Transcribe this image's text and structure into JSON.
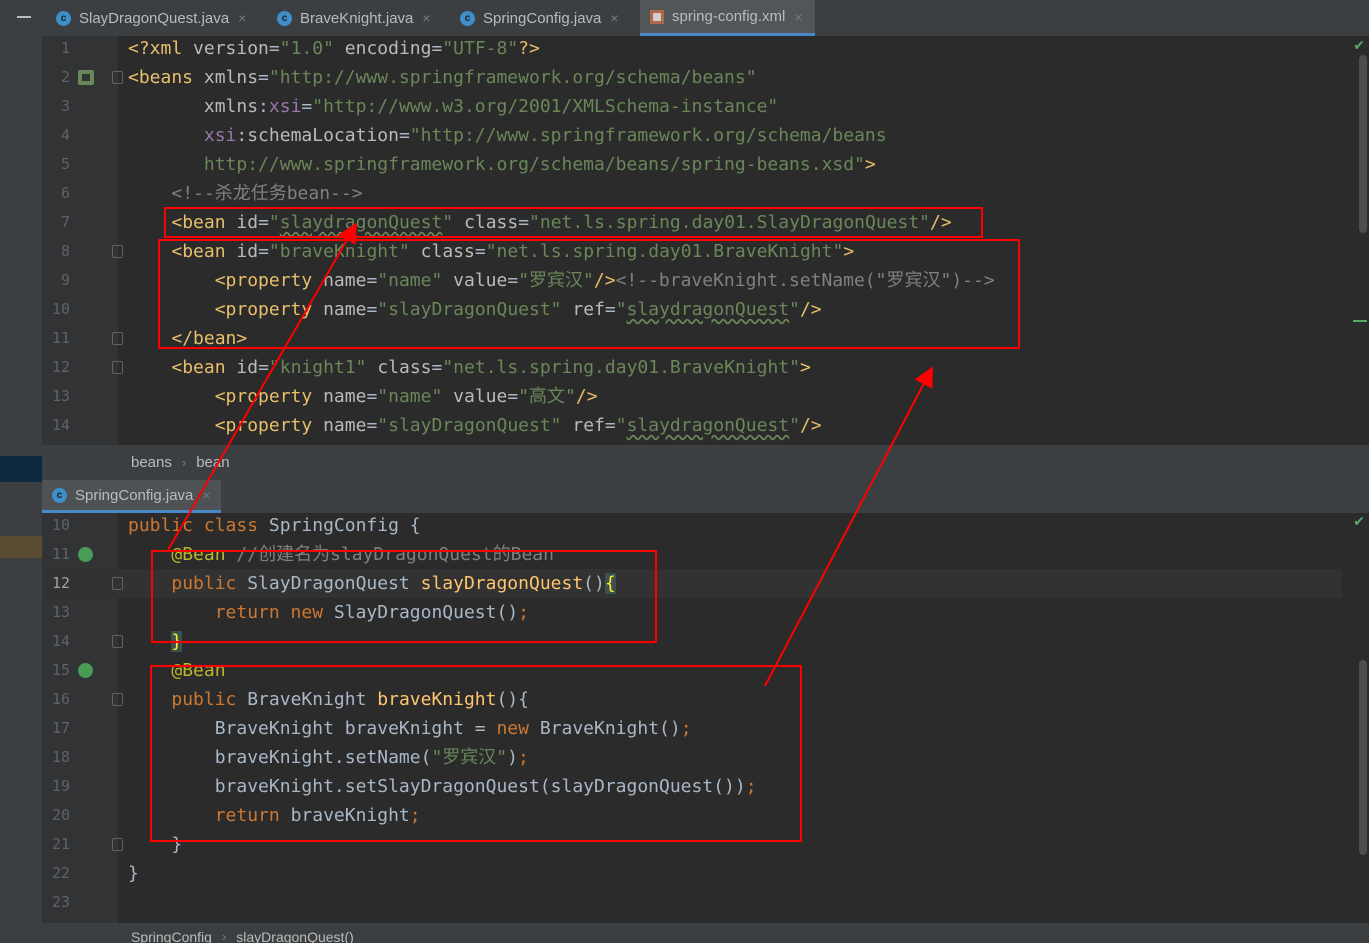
{
  "tabs": [
    {
      "label": "SlayDragonQuest.java",
      "icon": "java-class-icon",
      "close": "×"
    },
    {
      "label": "BraveKnight.java",
      "icon": "java-class-icon",
      "close": "×"
    },
    {
      "label": "SpringConfig.java",
      "icon": "java-class-icon",
      "close": "×"
    },
    {
      "label": "spring-config.xml",
      "icon": "xml-file-icon",
      "close": "×",
      "active": true
    }
  ],
  "xml_lines": [
    {
      "n": "1",
      "html": "<span class='t'>&lt;?xml </span><span class='an'>version</span>=<span class='av'>\"1.0\"</span> <span class='an'>encoding</span>=<span class='av'>\"UTF-8\"</span><span class='t'>?&gt;</span>"
    },
    {
      "n": "2",
      "html": "<span class='t'>&lt;beans </span><span class='an'>xmlns</span>=<span class='av'>\"http://www.springframework.org/schema/beans\"</span>"
    },
    {
      "n": "3",
      "html": "       <span class='an'>xmlns</span>:<span class='ns'>xsi</span>=<span class='av'>\"http://www.w3.org/2001/XMLSchema-instance\"</span>"
    },
    {
      "n": "4",
      "html": "       <span class='ns'>xsi</span>:<span class='an'>schemaLocation</span>=<span class='av'>\"http://www.springframework.org/schema/beans</span>"
    },
    {
      "n": "5",
      "html": "<span class='av'>       http://www.springframework.org/schema/beans/spring-beans.xsd\"</span><span class='t'>&gt;</span>"
    },
    {
      "n": "6",
      "html": "    <span class='cm'>&lt;!--杀龙任务bean--&gt;</span>"
    },
    {
      "n": "7",
      "html": "    <span class='t'>&lt;bean </span><span class='an'>id</span>=<span class='av'>\"<span class='wavy'>slaydragonQuest</span>\"</span> <span class='an'>class</span>=<span class='av'>\"net.ls.spring.day01.SlayDragonQuest\"</span><span class='t'>/&gt;</span>"
    },
    {
      "n": "8",
      "html": "    <span class='t'>&lt;bean </span><span class='an'>id</span>=<span class='av'>\"braveKnight\"</span> <span class='an'>class</span>=<span class='av'>\"net.ls.spring.day01.BraveKnight\"</span><span class='t'>&gt;</span>"
    },
    {
      "n": "9",
      "html": "        <span class='t'>&lt;property </span><span class='an'>name</span>=<span class='av'>\"name\"</span> <span class='an'>value</span>=<span class='av'>\"罗宾汉\"</span><span class='t'>/&gt;</span><span class='cm'>&lt;!--braveKnight.setName(\"罗宾汉\")--&gt;</span>"
    },
    {
      "n": "10",
      "html": "        <span class='t'>&lt;property </span><span class='an'>name</span>=<span class='av'>\"slayDragonQuest\"</span> <span class='an'>ref</span>=<span class='av'>\"<span class='wavy'>slaydragonQuest</span>\"</span><span class='t'>/&gt;</span>"
    },
    {
      "n": "11",
      "html": "    <span class='t'>&lt;/bean&gt;</span>"
    },
    {
      "n": "12",
      "html": "    <span class='t'>&lt;bean </span><span class='an'>id</span>=<span class='av'>\"knight1\"</span> <span class='an'>class</span>=<span class='av'>\"net.ls.spring.day01.BraveKnight\"</span><span class='t'>&gt;</span>"
    },
    {
      "n": "13",
      "html": "        <span class='t'>&lt;property </span><span class='an'>name</span>=<span class='av'>\"name\"</span> <span class='an'>value</span>=<span class='av'>\"高文\"</span><span class='t'>/&gt;</span>"
    },
    {
      "n": "14",
      "html": "        <span class='t'>&lt;property </span><span class='an'>name</span>=<span class='av'>\"slayDragonQuest\"</span> <span class='an'>ref</span>=<span class='av'>\"<span class='wavy'>slaydragonQuest</span>\"</span><span class='t'>/&gt;</span>"
    }
  ],
  "xml_breadcrumb": [
    "beans",
    "bean"
  ],
  "java_tab": {
    "label": "SpringConfig.java",
    "close": "×"
  },
  "java_lines": [
    {
      "n": "10",
      "html": "<span class='kw'>public class </span>SpringConfig {"
    },
    {
      "n": "11",
      "html": "    <span class='ann'>@Bean</span> <span class='cm'>//创建名为slayDragonQuest的Bean</span>"
    },
    {
      "n": "12",
      "html": "    <span class='kw'>public </span>SlayDragonQuest <span class='fn'>slayDragonQuest</span>()<span class='brace-hl'>{</span>"
    },
    {
      "n": "13",
      "html": "        <span class='kw'>return new </span>SlayDragonQuest()<span class='kw'>;</span>"
    },
    {
      "n": "14",
      "html": "    <span class='brace-hl'>}</span>"
    },
    {
      "n": "15",
      "html": "    <span class='ann'>@Bean</span>"
    },
    {
      "n": "16",
      "html": "    <span class='kw'>public </span>BraveKnight <span class='fn'>braveKnight</span>(){"
    },
    {
      "n": "17",
      "html": "        BraveKnight braveKnight = <span class='kw'>new </span>BraveKnight()<span class='kw'>;</span>"
    },
    {
      "n": "18",
      "html": "        braveKnight.setName(<span class='str'>\"罗宾汉\"</span>)<span class='kw'>;</span>"
    },
    {
      "n": "19",
      "html": "        braveKnight.setSlayDragonQuest(slayDragonQuest())<span class='kw'>;</span>"
    },
    {
      "n": "20",
      "html": "        <span class='kw'>return </span>braveKnight<span class='kw'>;</span>"
    },
    {
      "n": "21",
      "html": "    }"
    },
    {
      "n": "22",
      "html": "}"
    },
    {
      "n": "23",
      "html": ""
    }
  ],
  "java_breadcrumb": [
    "SpringConfig",
    "slayDragonQuest()"
  ],
  "colors": {
    "highlight_box": "#ff0000",
    "editor_bg": "#2b2b2b",
    "tab_accent": "#4a88c7"
  }
}
